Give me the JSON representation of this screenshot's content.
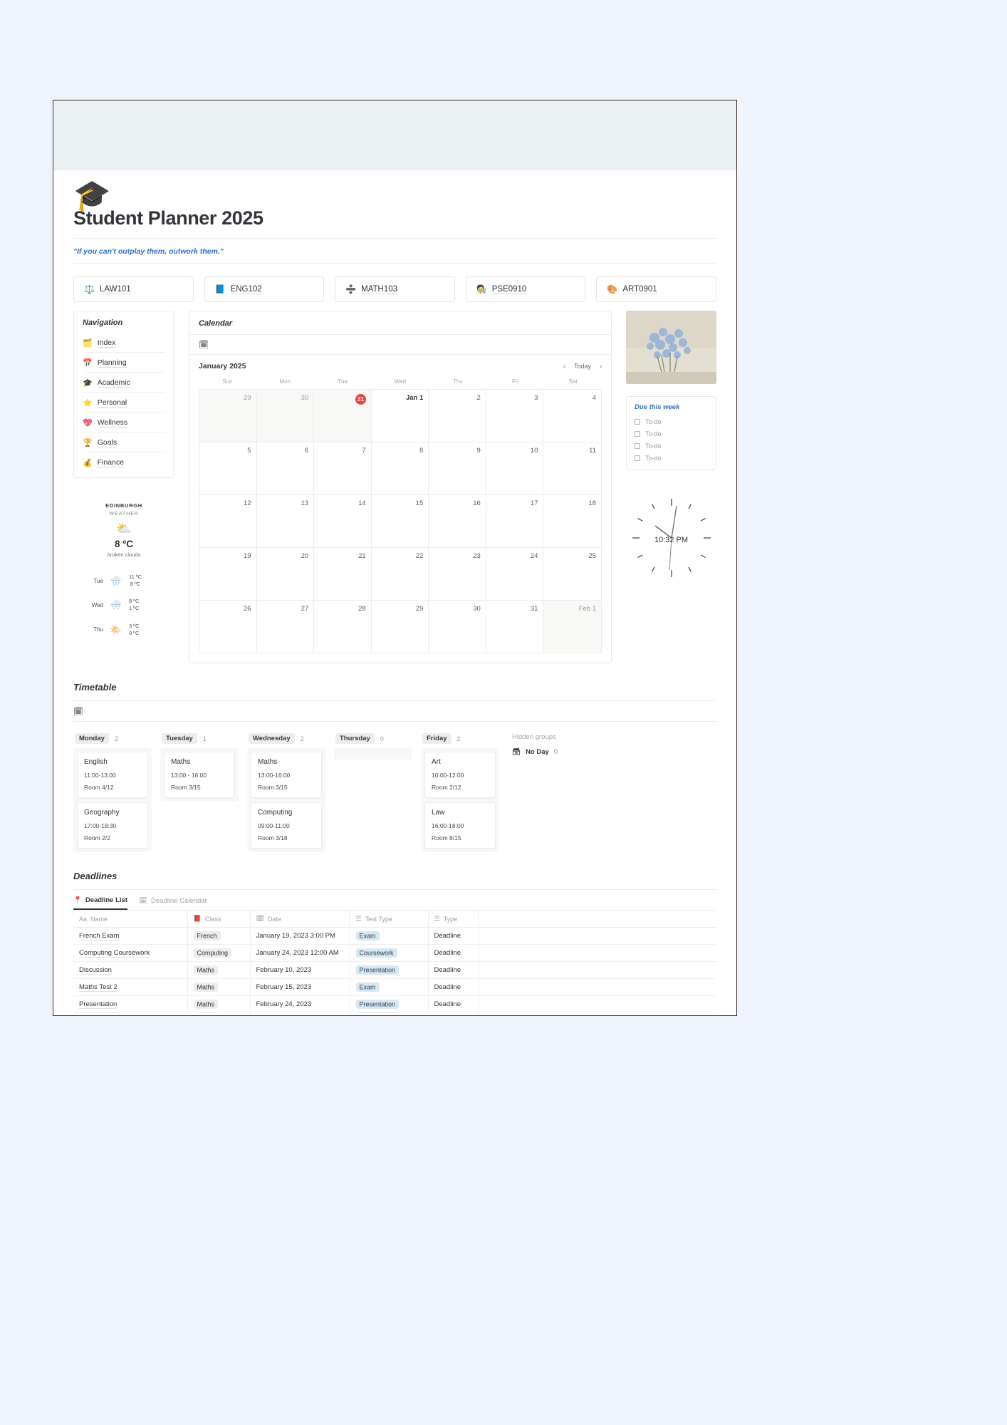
{
  "page": {
    "title": "Student Planner 2025",
    "icon": "graduation-cap-icon",
    "quote": "\"If you can't outplay them, outwork them.\""
  },
  "courses": [
    {
      "icon": "⚖️",
      "label": "LAW101"
    },
    {
      "icon": "📘",
      "label": "ENG102"
    },
    {
      "icon": "➗",
      "label": "MATH103"
    },
    {
      "icon": "🧑‍🔬",
      "label": "PSE0910"
    },
    {
      "icon": "🎨",
      "label": "ART0901"
    }
  ],
  "navigation": {
    "title": "Navigation",
    "items": [
      {
        "icon": "🗂️",
        "label": "Index"
      },
      {
        "icon": "📅",
        "label": "Planning"
      },
      {
        "icon": "🎓",
        "label": "Academic"
      },
      {
        "icon": "⭐",
        "label": "Personal"
      },
      {
        "icon": "💖",
        "label": "Wellness"
      },
      {
        "icon": "🏆",
        "label": "Goals"
      },
      {
        "icon": "💰",
        "label": "Finance"
      }
    ]
  },
  "weather": {
    "city": "EDINBURGH",
    "subtitle": "WEATHER",
    "icon": "⛅",
    "temp": "8 ºC",
    "description": "broken clouds",
    "forecast": [
      {
        "day": "Tue",
        "icon": "🌧️",
        "high": "11 ºC",
        "low": "8 ºC"
      },
      {
        "day": "Wed",
        "icon": "🌨️",
        "high": "8 ºC",
        "low": "1 ºC"
      },
      {
        "day": "Thu",
        "icon": "🌤️",
        "high": "3 ºC",
        "low": "0 ºC"
      }
    ]
  },
  "calendar": {
    "heading": "Calendar",
    "toolbar_icon": "calendar-icon",
    "month": "January 2025",
    "today_label": "Today",
    "prev_label": "‹",
    "next_label": "›",
    "dow": [
      "Sun",
      "Mon",
      "Tue",
      "Wed",
      "Thu",
      "Fri",
      "Sat"
    ],
    "today": "31",
    "weeks": [
      [
        {
          "t": "29",
          "off": true
        },
        {
          "t": "30",
          "off": true
        },
        {
          "t": "31",
          "off": true,
          "today": true
        },
        {
          "t": "Jan 1",
          "first": true
        },
        {
          "t": "2"
        },
        {
          "t": "3"
        },
        {
          "t": "4"
        }
      ],
      [
        {
          "t": "5"
        },
        {
          "t": "6"
        },
        {
          "t": "7"
        },
        {
          "t": "8"
        },
        {
          "t": "9"
        },
        {
          "t": "10"
        },
        {
          "t": "11"
        }
      ],
      [
        {
          "t": "12"
        },
        {
          "t": "13"
        },
        {
          "t": "14"
        },
        {
          "t": "15"
        },
        {
          "t": "16"
        },
        {
          "t": "17"
        },
        {
          "t": "18"
        }
      ],
      [
        {
          "t": "19"
        },
        {
          "t": "20"
        },
        {
          "t": "21"
        },
        {
          "t": "22"
        },
        {
          "t": "23"
        },
        {
          "t": "24"
        },
        {
          "t": "25"
        }
      ],
      [
        {
          "t": "26"
        },
        {
          "t": "27"
        },
        {
          "t": "28"
        },
        {
          "t": "29"
        },
        {
          "t": "30"
        },
        {
          "t": "31"
        },
        {
          "t": "Feb 1",
          "off": true
        }
      ]
    ]
  },
  "due_this_week": {
    "title": "Due this week",
    "items": [
      "To-do",
      "To-do",
      "To-do",
      "To-do"
    ]
  },
  "clock": {
    "time": "10:32 PM"
  },
  "timetable": {
    "heading": "Timetable",
    "toolbar_icon": "calendar-icon",
    "hidden_groups_label": "Hidden groups",
    "hidden_group": {
      "icon": "🗃",
      "label": "No Day",
      "count": "0"
    },
    "columns": [
      {
        "day": "Monday",
        "count": "2",
        "cards": [
          {
            "title": "English",
            "time": "11:00-13:00",
            "room": "Room 4/12"
          },
          {
            "title": "Geography",
            "time": "17:00-18:30",
            "room": "Room 2/2"
          }
        ]
      },
      {
        "day": "Tuesday",
        "count": "1",
        "cards": [
          {
            "title": "Maths",
            "time": "13:00 - 16:00",
            "room": "Room 3/15"
          }
        ]
      },
      {
        "day": "Wednesday",
        "count": "2",
        "cards": [
          {
            "title": "Maths",
            "time": "13:00-16:00",
            "room": "Room 3/15"
          },
          {
            "title": "Computing",
            "time": "09:00-11:00",
            "room": "Room 3/18"
          }
        ]
      },
      {
        "day": "Thursday",
        "count": "0",
        "cards": []
      },
      {
        "day": "Friday",
        "count": "2",
        "cards": [
          {
            "title": "Art",
            "time": "10:00-12:00",
            "room": "Room 2/12"
          },
          {
            "title": "Law",
            "time": "16:00-18:00",
            "room": "Room 8/15"
          }
        ]
      }
    ]
  },
  "deadlines": {
    "heading": "Deadlines",
    "tabs": [
      {
        "icon": "📍",
        "label": "Deadline List",
        "active": true
      },
      {
        "icon": "🗓",
        "label": "Deadline Calendar",
        "active": false
      }
    ],
    "columns": [
      {
        "icon": "Aa",
        "label": "Name"
      },
      {
        "icon": "📕",
        "label": "Class"
      },
      {
        "icon": "🗓",
        "label": "Date"
      },
      {
        "icon": "☰",
        "label": "Test Type"
      },
      {
        "icon": "☰",
        "label": "Type"
      }
    ],
    "rows": [
      {
        "name": "French Exam",
        "class": "French",
        "date": "January 19, 2023 3:00 PM",
        "test_type": "Exam",
        "type": "Deadline"
      },
      {
        "name": "Computing Coursework",
        "class": "Computing",
        "date": "January 24, 2023 12:00 AM",
        "test_type": "Coursework",
        "type": "Deadline"
      },
      {
        "name": "Discussion",
        "class": "Maths",
        "date": "February 10, 2023",
        "test_type": "Presentation",
        "type": "Deadline"
      },
      {
        "name": "Maths Test 2",
        "class": "Maths",
        "date": "February 15, 2023",
        "test_type": "Exam",
        "type": "Deadline"
      },
      {
        "name": "Presentation",
        "class": "Maths",
        "date": "February 24, 2023",
        "test_type": "Presentation",
        "type": "Deadline"
      }
    ]
  },
  "colors": {
    "accent_blue": "#2f6fc4",
    "today_red": "#e8453c",
    "pill_blue": "#d7e8f5",
    "pill_gray": "#ededeb",
    "page_bg": "#eef3fc"
  }
}
